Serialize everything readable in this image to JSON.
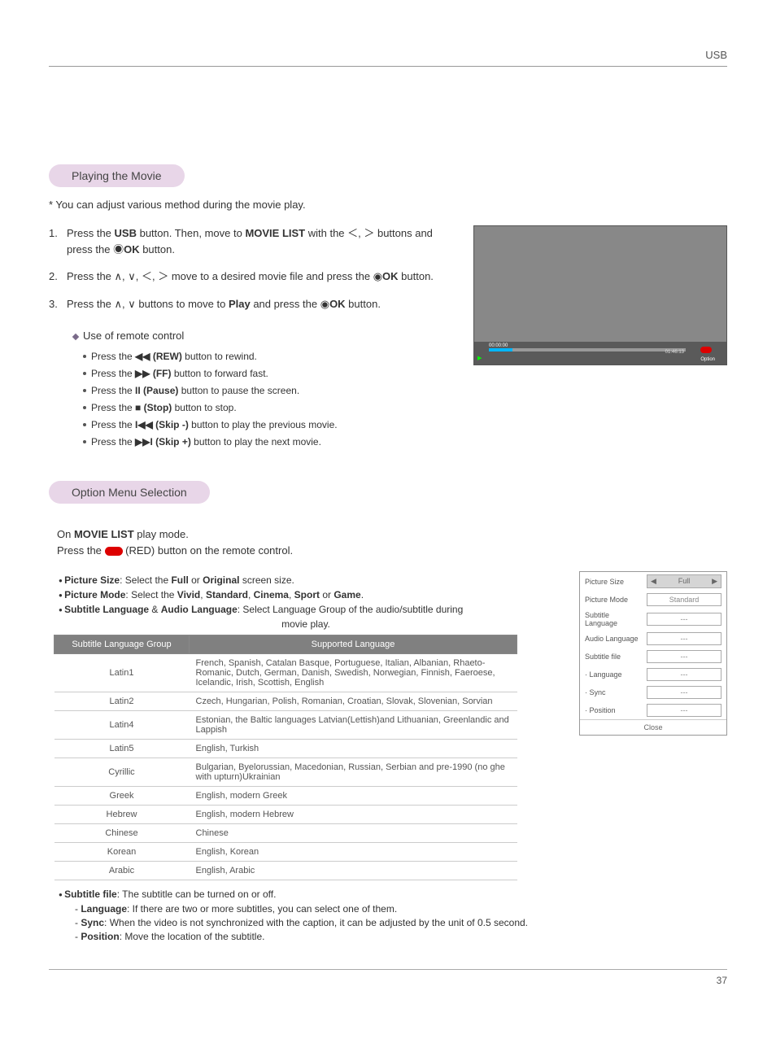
{
  "header": {
    "title": "USB"
  },
  "section1": {
    "title": "Playing the Movie",
    "note": "* You can adjust various method during the movie play.",
    "steps": {
      "1": {
        "num": "1.",
        "a": "Press the ",
        "b1": "USB",
        "c": " button. Then, move to ",
        "b2": "MOVIE LIST",
        "d": " with the ＜, ＞ buttons and press the ◉",
        "b3": "OK",
        "e": " button."
      },
      "2": {
        "num": "2.",
        "a": "Press the ∧, ∨, ＜, ＞  move to a desired movie file and press the ◉",
        "b1": "OK",
        "c": " button."
      },
      "3": {
        "num": "3.",
        "a": "Press the ∧, ∨  buttons to move to ",
        "b1": "Play",
        "c": " and press the ◉",
        "b2": "OK",
        "d": " button."
      }
    },
    "remote": {
      "title": "Use of remote control",
      "items": [
        {
          "pre": "Press the ",
          "icon": "◀◀",
          "label": "(REW)",
          "post": " button to rewind."
        },
        {
          "pre": "Press the ",
          "icon": "▶▶",
          "label": "(FF)",
          "post": " button to forward fast."
        },
        {
          "pre": "Press the ",
          "icon": "II",
          "label": "(Pause)",
          "post": " button to pause the screen."
        },
        {
          "pre": "Press the ",
          "icon": "■",
          "label": "(Stop)",
          "post": " button to stop."
        },
        {
          "pre": "Press the ",
          "icon": "I◀◀",
          "label": "(Skip -)",
          "post": " button to play the previous movie."
        },
        {
          "pre": "Press the ",
          "icon": "▶▶I",
          "label": "(Skip +)",
          "post": " button to play the next movie."
        }
      ]
    },
    "player": {
      "time_l": "00:00:00",
      "time_r": "01:46:13",
      "option": "Option"
    }
  },
  "section2": {
    "title": "Option Menu Selection",
    "intro_a": "On ",
    "intro_b": "MOVIE LIST",
    "intro_c": " play mode.",
    "intro_d": "Press the ",
    "intro_e": " (RED) button on the remote control.",
    "opts": [
      {
        "b": "Picture Size",
        "t": ": Select the ",
        "b2": "Full",
        "t2": " or ",
        "b3": "Original",
        "t3": " screen size."
      },
      {
        "b": "Picture Mode",
        "t": ": Select the ",
        "b2": "Vivid",
        "t2": ", ",
        "b3": "Standard",
        "t3": ", ",
        "b4": "Cinema",
        "t4": ", ",
        "b5": "Sport",
        "t5": " or ",
        "b6": "Game",
        "t6": "."
      },
      {
        "b": "Subtitle Language",
        "t": " & ",
        "b2": "Audio Language",
        "t2": ": Select Language Group of the audio/subtitle during"
      }
    ],
    "center_note": "movie play.",
    "panel": {
      "rows": [
        {
          "label": "Picture Size",
          "value": "Full",
          "sel": true
        },
        {
          "label": "Picture Mode",
          "value": "Standard"
        },
        {
          "label": "Subtitle Language",
          "value": "---"
        },
        {
          "label": "Audio Language",
          "value": "---"
        },
        {
          "label": "Subtitle file",
          "value": "---"
        },
        {
          "label": "· Language",
          "value": "---"
        },
        {
          "label": "· Sync",
          "value": "---"
        },
        {
          "label": "· Position",
          "value": "---"
        }
      ],
      "close": "Close"
    },
    "table": {
      "h1": "Subtitle Language Group",
      "h2": "Supported Language",
      "rows": [
        {
          "g": "Latin1",
          "s": "French, Spanish, Catalan Basque, Portuguese, Italian, Albanian, Rhaeto-Romanic, Dutch, German, Danish, Swedish, Norwegian, Finnish, Faeroese, Icelandic, Irish, Scottish, English"
        },
        {
          "g": "Latin2",
          "s": "Czech, Hungarian, Polish, Romanian, Croatian, Slovak, Slovenian, Sorvian"
        },
        {
          "g": "Latin4",
          "s": "Estonian, the Baltic languages Latvian(Lettish)and Lithuanian, Greenlandic and Lappish"
        },
        {
          "g": "Latin5",
          "s": "English, Turkish"
        },
        {
          "g": "Cyrillic",
          "s": "Bulgarian, Byelorussian, Macedonian, Russian, Serbian and pre-1990 (no ghe with upturn)Ukrainian"
        },
        {
          "g": "Greek",
          "s": "English, modern Greek"
        },
        {
          "g": "Hebrew",
          "s": "English, modern Hebrew"
        },
        {
          "g": "Chinese",
          "s": "Chinese"
        },
        {
          "g": "Korean",
          "s": "English, Korean"
        },
        {
          "g": "Arabic",
          "s": "English, Arabic"
        }
      ]
    },
    "after": {
      "li": {
        "b": "Subtitle file",
        "t": ": The subtitle can be turned on or off."
      },
      "subs": [
        {
          "b": "Language",
          "t": ": If there are two or more subtitles, you can select one of them."
        },
        {
          "b": "Sync",
          "t": ": When the video is not synchronized with the caption, it can be adjusted by the unit of 0.5 second."
        },
        {
          "b": "Position",
          "t": ": Move the location of the subtitle."
        }
      ]
    }
  },
  "page": "37"
}
